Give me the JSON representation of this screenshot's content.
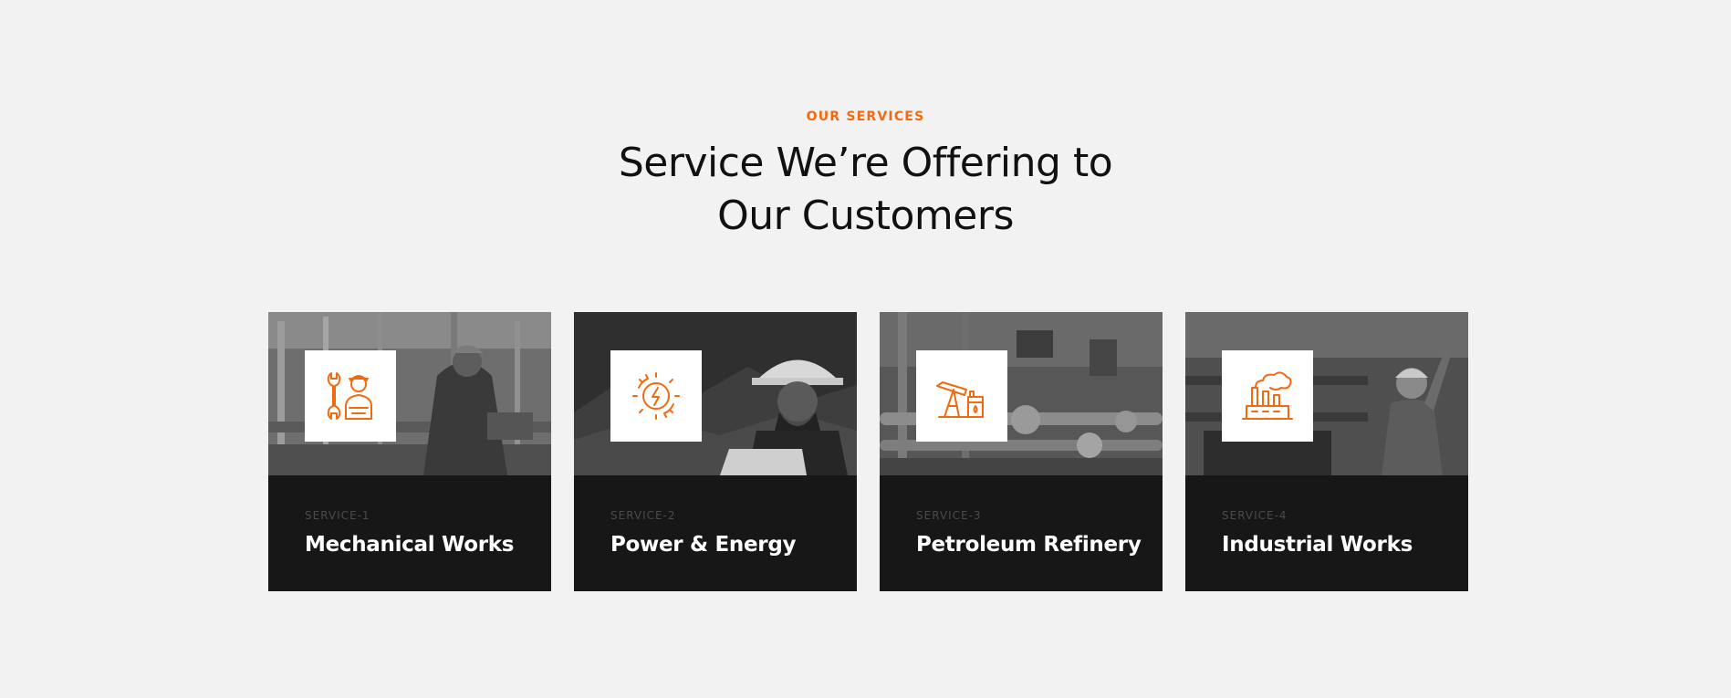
{
  "section": {
    "tag": "OUR SERVICES",
    "title_line1": "Service We’re Offering to",
    "title_line2": "Our Customers"
  },
  "services": [
    {
      "number": "SERVICE-1",
      "title": "Mechanical Works",
      "icon": "mechanic-wrench-icon"
    },
    {
      "number": "SERVICE-2",
      "title": "Power & Energy",
      "icon": "power-energy-gear-icon"
    },
    {
      "number": "SERVICE-3",
      "title": "Petroleum Refinery",
      "icon": "oil-pump-refinery-icon"
    },
    {
      "number": "SERVICE-4",
      "title": "Industrial Works",
      "icon": "factory-icon"
    }
  ],
  "colors": {
    "accent": "#f26a10",
    "background": "#f2f2f2",
    "card": "#171717",
    "title": "#111111"
  }
}
